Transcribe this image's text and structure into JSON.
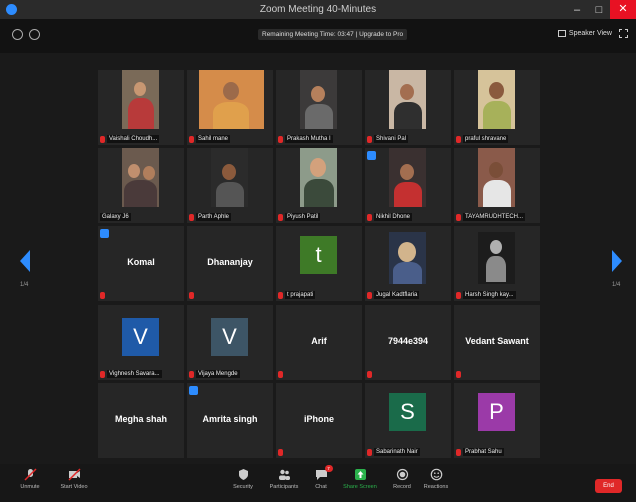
{
  "window": {
    "title": "Zoom Meeting 40-Minutes"
  },
  "top": {
    "remaining": "Remaining Meeting Time: 03:47 | Upgrade to Pro",
    "speaker_view": "Speaker View"
  },
  "pager": {
    "left": "1/4",
    "right": "1/4"
  },
  "participants": [
    {
      "name": "Vaishali Choudh..."
    },
    {
      "name": "Sahil mane"
    },
    {
      "name": "Prakash Mutha I"
    },
    {
      "name": "Shivani Pal"
    },
    {
      "name": "praful shravane"
    },
    {
      "name": "Galaxy J6"
    },
    {
      "name": "Parth Aphle"
    },
    {
      "name": "Piyush Patil"
    },
    {
      "name": "Nikhil Dhone"
    },
    {
      "name": "TAYAMRUDHTECH..."
    },
    {
      "name": "Komal"
    },
    {
      "name": "Dhananjay"
    },
    {
      "name": "t prajapati",
      "letter": "t",
      "color": "#3e7a27"
    },
    {
      "name": "Jugal Kadtflaria"
    },
    {
      "name": "Harsh Singh kay..."
    },
    {
      "name": "Vighnesh Savara...",
      "letter": "V",
      "color": "#1f5aa8"
    },
    {
      "name": "Vijaya Mengde",
      "letter": "V",
      "color": "#3d5566"
    },
    {
      "name": "Arif"
    },
    {
      "name": "7944e394"
    },
    {
      "name": "Vedant Sawant"
    },
    {
      "name": "Megha shah"
    },
    {
      "name": "Amrita singh"
    },
    {
      "name": "iPhone"
    },
    {
      "name": "Sabarinath Nair",
      "letter": "S",
      "color": "#1a6b4a"
    },
    {
      "name": "Prabhat Sahu",
      "letter": "P",
      "color": "#9b3aa8"
    }
  ],
  "toolbar": {
    "unmute": "Unmute",
    "start_video": "Start Video",
    "security": "Security",
    "participants": "Participants",
    "participants_count": "27",
    "chat": "Chat",
    "chat_badge": "7",
    "share_screen": "Share Screen",
    "record": "Record",
    "reactions": "Reactions",
    "end": "End"
  }
}
